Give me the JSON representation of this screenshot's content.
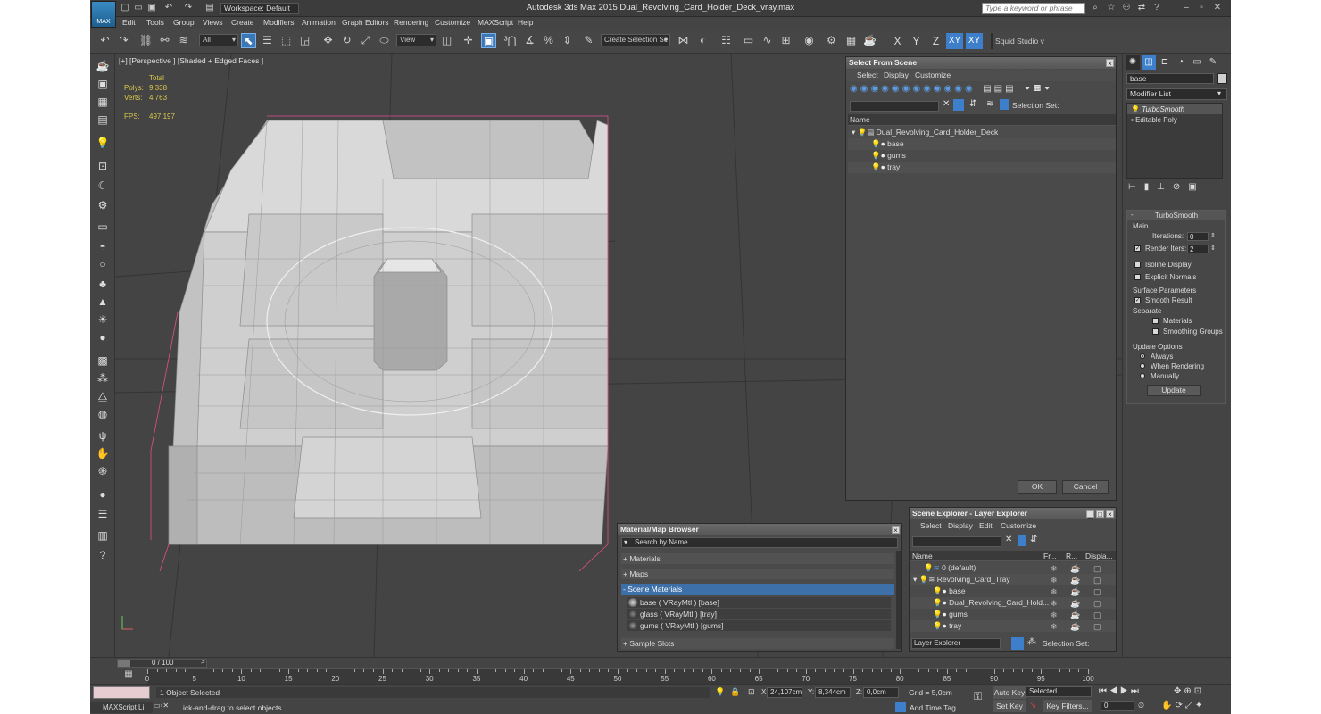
{
  "app": {
    "title": "Autodesk 3ds Max  2015    Dual_Revolving_Card_Holder_Deck_vray.max",
    "logo": "MAX",
    "workspace": "Workspace: Default",
    "search_placeholder": "Type a keyword or phrase"
  },
  "menu": [
    "Edit",
    "Tools",
    "Group",
    "Views",
    "Create",
    "Modifiers",
    "Animation",
    "Graph Editors",
    "Rendering",
    "Customize",
    "MAXScript",
    "Help"
  ],
  "toolbar": {
    "filter": "All",
    "refcoord": "View",
    "selset": "Create Selection Se",
    "spinner_label": "Squid Studio v",
    "axes": [
      "X",
      "Y",
      "Z",
      "XY",
      "XY"
    ]
  },
  "viewport": {
    "label": "[+] [Perspective ] [Shaded + Edged Faces ]",
    "stats": {
      "total": "Total",
      "polys_label": "Polys:",
      "polys": "9 338",
      "verts_label": "Verts:",
      "verts": "4 763",
      "fps_label": "FPS:",
      "fps": "497,197"
    }
  },
  "select_from_scene": {
    "title": "Select From Scene",
    "menu": [
      "Select",
      "Display",
      "Customize"
    ],
    "selection_set_label": "Selection Set:",
    "column": "Name",
    "tree": [
      {
        "name": "Dual_Revolving_Card_Holder_Deck",
        "level": 0
      },
      {
        "name": "base",
        "level": 1
      },
      {
        "name": "gums",
        "level": 1
      },
      {
        "name": "tray",
        "level": 1
      }
    ],
    "ok": "OK",
    "cancel": "Cancel"
  },
  "material_browser": {
    "title": "Material/Map Browser",
    "search_placeholder": "Search by Name ...",
    "groups": {
      "materials": "+ Materials",
      "maps": "+ Maps",
      "scene_materials": "- Scene Materials",
      "sample_slots": "+ Sample Slots"
    },
    "items": [
      "base  ( VRayMtl )  [base]",
      "glass  ( VRayMtl )  [tray]",
      "gums  ( VRayMtl )  [gums]"
    ]
  },
  "scene_explorer": {
    "title": "Scene Explorer - Layer Explorer",
    "menu": [
      "Select",
      "Display",
      "Edit",
      "Customize"
    ],
    "columns": [
      "Name",
      "Fr...",
      "R...",
      "Displa..."
    ],
    "rows": [
      {
        "name": "0 (default)",
        "level": 1
      },
      {
        "name": "Revolving_Card_Tray",
        "level": 0
      },
      {
        "name": "base",
        "level": 2
      },
      {
        "name": "Dual_Revolving_Card_Hold...",
        "level": 2
      },
      {
        "name": "gums",
        "level": 2
      },
      {
        "name": "tray",
        "level": 2
      }
    ],
    "footer_explorer": "Layer Explorer",
    "footer_selset": "Selection Set:"
  },
  "command_panel": {
    "object_name": "base",
    "modifier_list": "Modifier List",
    "stack": [
      "TurboSmooth",
      "Editable Poly"
    ],
    "turbosmooth": {
      "title": "TurboSmooth",
      "main": "Main",
      "iterations_label": "Iterations:",
      "iterations": "0",
      "render_iters_label": "Render Iters:",
      "render_iters": "2",
      "isoline": "Isoline Display",
      "explicit": "Explicit Normals",
      "surface": "Surface Parameters",
      "smooth_result": "Smooth Result",
      "separate": "Separate",
      "materials": "Materials",
      "smoothing_groups": "Smoothing Groups",
      "update_options": "Update Options",
      "always": "Always",
      "when_rendering": "When Rendering",
      "manually": "Manually",
      "update": "Update"
    }
  },
  "timeline": {
    "frame": "0 / 100",
    "ticks": [
      "0",
      "5",
      "10",
      "15",
      "20",
      "25",
      "30",
      "35",
      "40",
      "45",
      "50",
      "55",
      "60",
      "65",
      "70",
      "75",
      "80",
      "85",
      "90",
      "95",
      "100"
    ]
  },
  "status": {
    "selected": "1 Object Selected",
    "prompt": "ick-and-drag to select objects",
    "maxscript": "MAXScript Li",
    "x_label": "X:",
    "x": "24,107cm",
    "y_label": "Y:",
    "y": "8,344cm",
    "z_label": "Z:",
    "z": "0,0cm",
    "grid": "Grid = 5,0cm",
    "add_time_tag": "Add Time Tag",
    "auto_key": "Auto Key",
    "set_key": "Set Key",
    "key_mode": "Selected",
    "key_filters": "Key Filters...",
    "frame_field": "0"
  },
  "colors": {
    "ui_bg": "#444444",
    "accent": "#3d7fcb",
    "stats": "#d9c84a"
  }
}
